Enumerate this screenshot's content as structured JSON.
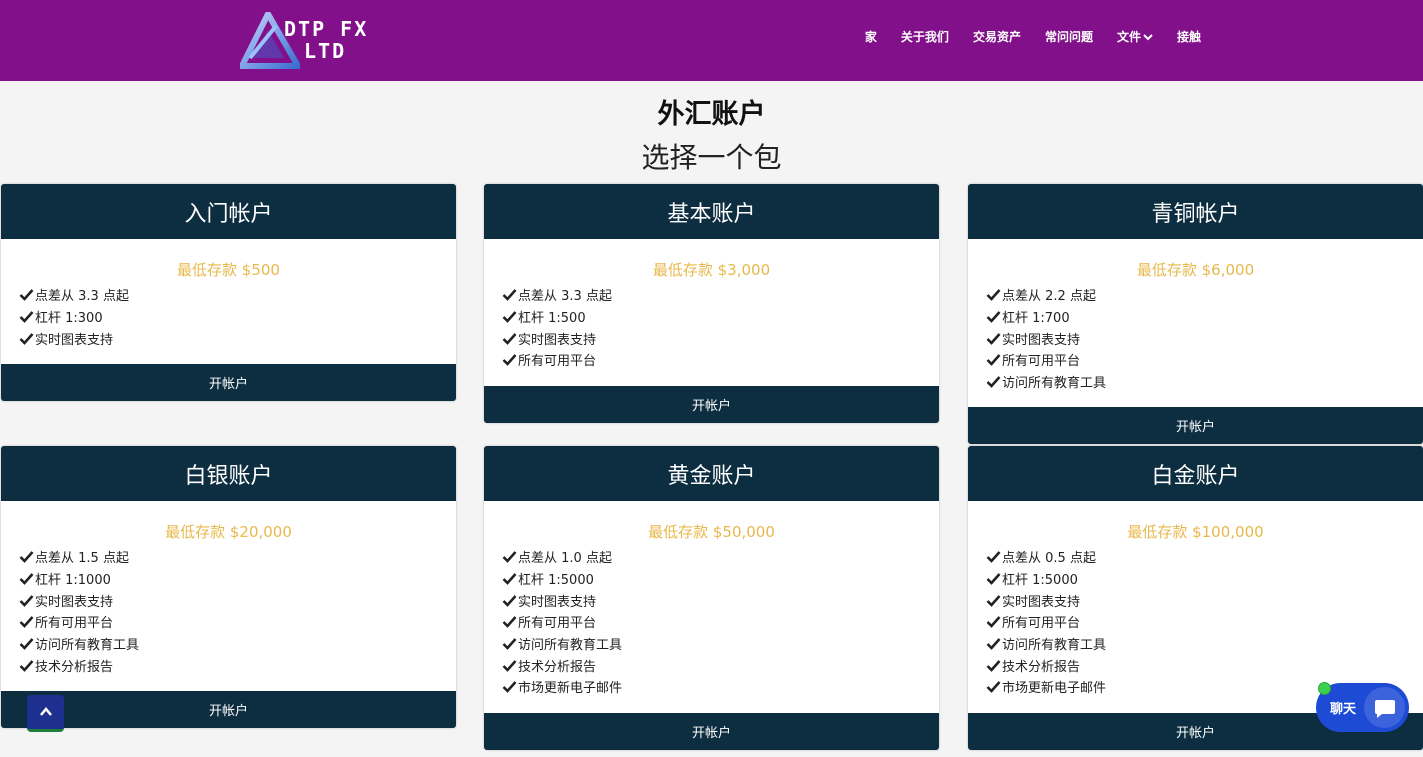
{
  "brand": {
    "name_line1": "DTP FX",
    "name_line2": "LTD",
    "nav_bg": "#81108a"
  },
  "nav": {
    "items": [
      "家",
      "关于我们",
      "交易资产",
      "常问问题",
      "文件",
      "接触"
    ]
  },
  "page": {
    "title": "外汇账户",
    "subtitle": "选择一个包"
  },
  "accent": {
    "header": "#0d2d40",
    "price": "#e8b84a"
  },
  "cards": [
    {
      "title": "入门帐户",
      "price": "最低存款 $500",
      "features": [
        "点差从 3.3 点起",
        "杠杆 1:300",
        "实时图表支持"
      ],
      "button": "开帐户"
    },
    {
      "title": "基本账户",
      "price": "最低存款 $3,000",
      "features": [
        "点差从 3.3 点起",
        "杠杆 1:500",
        "实时图表支持",
        "所有可用平台"
      ],
      "button": "开帐户"
    },
    {
      "title": "青铜帐户",
      "price": "最低存款 $6,000",
      "features": [
        "点差从 2.2 点起",
        "杠杆 1:700",
        "实时图表支持",
        "所有可用平台",
        "访问所有教育工具"
      ],
      "button": "开帐户"
    },
    {
      "title": "白银账户",
      "price": "最低存款 $20,000",
      "features": [
        "点差从 1.5 点起",
        "杠杆 1:1000",
        "实时图表支持",
        "所有可用平台",
        "访问所有教育工具",
        "技术分析报告"
      ],
      "button": "开帐户"
    },
    {
      "title": "黄金账户",
      "price": "最低存款 $50,000",
      "features": [
        "点差从 1.0 点起",
        "杠杆 1:5000",
        "实时图表支持",
        "所有可用平台",
        "访问所有教育工具",
        "技术分析报告",
        "市场更新电子邮件"
      ],
      "button": "开帐户"
    },
    {
      "title": "白金账户",
      "price": "最低存款 $100,000",
      "features": [
        "点差从 0.5 点起",
        "杠杆 1:5000",
        "实时图表支持",
        "所有可用平台",
        "访问所有教育工具",
        "技术分析报告",
        "市场更新电子邮件"
      ],
      "button": "开帐户"
    }
  ],
  "chat": {
    "label": "聊天"
  }
}
